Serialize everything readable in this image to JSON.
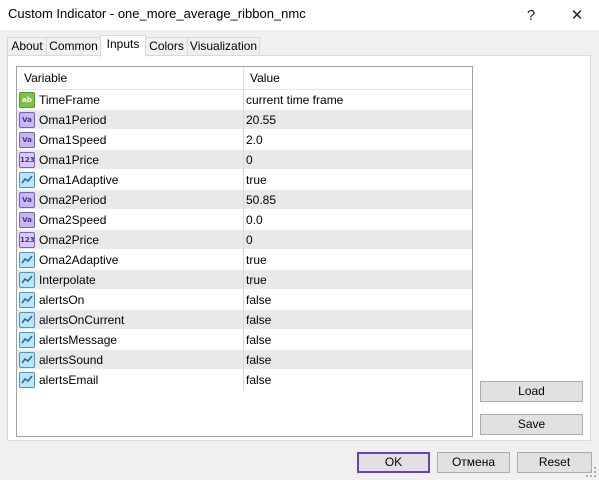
{
  "window": {
    "title": "Custom Indicator - one_more_average_ribbon_nmc",
    "help_glyph": "?",
    "close_glyph": "✕"
  },
  "tabs": [
    {
      "label": "About",
      "active": false
    },
    {
      "label": "Common",
      "active": false
    },
    {
      "label": "Inputs",
      "active": true
    },
    {
      "label": "Colors",
      "active": false
    },
    {
      "label": "Visualization",
      "active": false
    }
  ],
  "grid": {
    "columns": [
      "Variable",
      "Value"
    ],
    "rows": [
      {
        "name": "TimeFrame",
        "value": "current time frame",
        "icon": "string-icon"
      },
      {
        "name": "Oma1Period",
        "value": "20.55",
        "icon": "double-icon"
      },
      {
        "name": "Oma1Speed",
        "value": "2.0",
        "icon": "double-icon"
      },
      {
        "name": "Oma1Price",
        "value": "0",
        "icon": "integer-icon"
      },
      {
        "name": "Oma1Adaptive",
        "value": "true",
        "icon": "bool-icon"
      },
      {
        "name": "Oma2Period",
        "value": "50.85",
        "icon": "double-icon"
      },
      {
        "name": "Oma2Speed",
        "value": "0.0",
        "icon": "double-icon"
      },
      {
        "name": "Oma2Price",
        "value": "0",
        "icon": "integer-icon"
      },
      {
        "name": "Oma2Adaptive",
        "value": "true",
        "icon": "bool-icon"
      },
      {
        "name": "Interpolate",
        "value": "true",
        "icon": "bool-icon"
      },
      {
        "name": "alertsOn",
        "value": "false",
        "icon": "bool-icon"
      },
      {
        "name": "alertsOnCurrent",
        "value": "false",
        "icon": "bool-icon"
      },
      {
        "name": "alertsMessage",
        "value": "false",
        "icon": "bool-icon"
      },
      {
        "name": "alertsSound",
        "value": "false",
        "icon": "bool-icon"
      },
      {
        "name": "alertsEmail",
        "value": "false",
        "icon": "bool-icon"
      }
    ]
  },
  "icon_glyphs": {
    "string": "ab",
    "double": "Va",
    "integer": "123"
  },
  "buttons": {
    "load": "Load",
    "save": "Save",
    "ok": "OK",
    "cancel": "Отмена",
    "reset": "Reset"
  },
  "colors": {
    "ok_border": "#6a3fbf",
    "row_alt": "#e9e9e9"
  }
}
